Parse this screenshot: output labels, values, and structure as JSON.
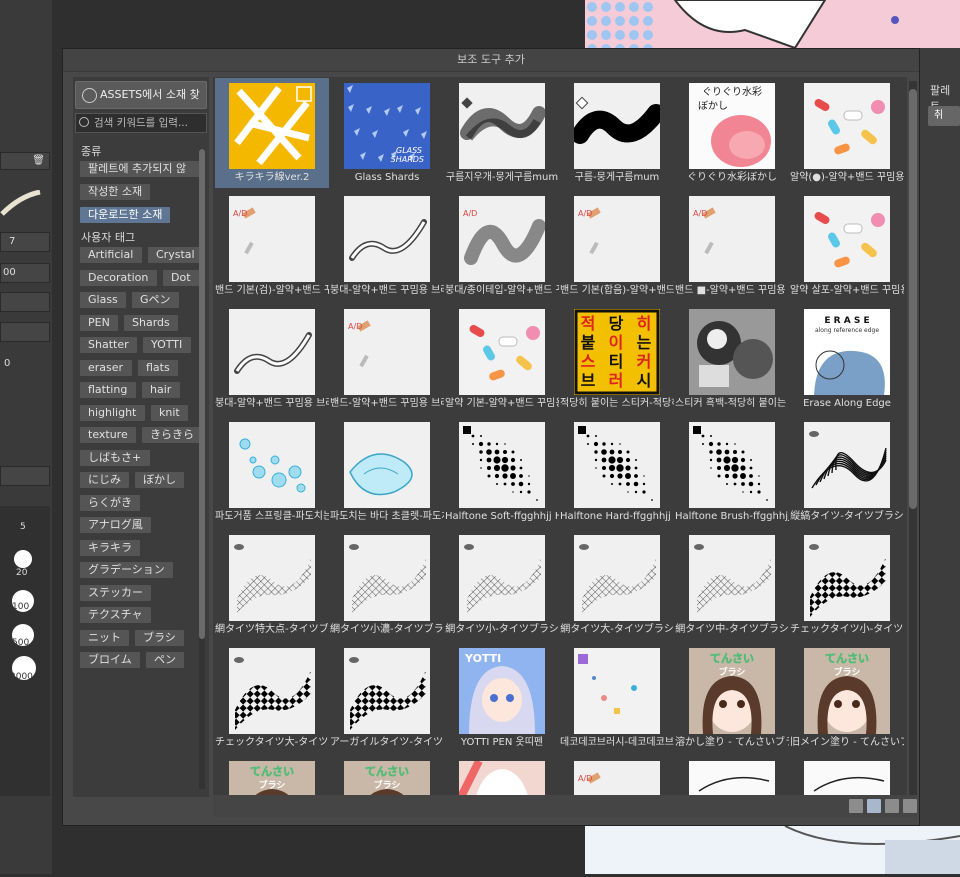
{
  "dialog": {
    "title": "보조 도구 추가",
    "assets_button": "ASSETS에서 소재 찾기",
    "search_placeholder": "검색 키워드를 입력...",
    "type_section": "종류",
    "type_items": [
      {
        "label": "팔레트에 추가되지 않",
        "selected": false
      },
      {
        "label": "작성한 소재",
        "selected": false
      },
      {
        "label": "다운로드한 소재",
        "selected": true
      }
    ],
    "user_tag_section": "사용자 태그",
    "tags": [
      "Artificial",
      "Crystal",
      "Decoration",
      "Dot",
      "Glass",
      "Gペン",
      "PEN",
      "Shards",
      "Shatter",
      "YOTTI",
      "eraser",
      "flats",
      "flatting",
      "hair",
      "highlight",
      "knit",
      "texture",
      "きらきら",
      "しばもさ+",
      "にじみ",
      "ぼかし",
      "らくがき",
      "アナログ風",
      "キラキラ",
      "グラデーション",
      "ステッカー",
      "テクスチャ",
      "ニット",
      "ブラシ",
      "ブロイム",
      "ペン"
    ],
    "items": [
      {
        "caption": "キラキラ線ver.2",
        "selected": true,
        "icon": "sparkle-lines"
      },
      {
        "caption": "Glass Shards",
        "icon": "glass-shards"
      },
      {
        "caption": "구름지우개-뭉게구름mum",
        "icon": "cloud-eraser"
      },
      {
        "caption": "구름-뭉게구름mum",
        "icon": "cloud-brush"
      },
      {
        "caption": "ぐりぐり水彩ぼかし",
        "icon": "watercolor"
      },
      {
        "caption": "알약(●)-알약+밴드 꾸밈용 브",
        "icon": "pill"
      },
      {
        "caption": "밴드 기본(검)-알약+밴드 꾸밈",
        "icon": "bandage"
      },
      {
        "caption": "붕대-알약+밴드 꾸밈용 브러",
        "icon": "wave-stroke"
      },
      {
        "caption": "붕대/종이테입-알약+밴드 꾸",
        "icon": "tape-stroke"
      },
      {
        "caption": "밴드 기본(합음)-알약+밴드 꾸",
        "icon": "bandage"
      },
      {
        "caption": "밴드 ■-알약+밴드 꾸밈용 브",
        "icon": "bandage"
      },
      {
        "caption": "알약 살포-알약+밴드 꾸밈용",
        "icon": "pill"
      },
      {
        "caption": "붕대-알약+밴드 꾸밈용 브러",
        "icon": "wave-stroke"
      },
      {
        "caption": "밴드-알약+밴드 꾸밈용 브러",
        "icon": "bandage"
      },
      {
        "caption": "알약 기본-알약+밴드 꾸밈용",
        "icon": "pill"
      },
      {
        "caption": "적당히 붙이는 스티커-적당히",
        "icon": "sticker",
        "thumb_text": "적 당 히 붙 이 는 스 티 커 브 러 시"
      },
      {
        "caption": "스티커 흑백-적당히 붙이는 스",
        "icon": "sticker-bw"
      },
      {
        "caption": "Erase Along Edge",
        "icon": "erase-edge",
        "thumb_text": "E R A S E",
        "thumb_subtext": "along reference edge"
      },
      {
        "caption": "파도거품 스프링클-파도치는",
        "icon": "bubbles"
      },
      {
        "caption": "파도치는 바다 초클렛-파도치",
        "icon": "shell"
      },
      {
        "caption": "Halftone Soft-ffgghhjj Halfto",
        "icon": "halftone"
      },
      {
        "caption": "Halftone Hard-ffgghhjj Halfto",
        "icon": "halftone"
      },
      {
        "caption": "Halftone Brush-ffgghhjj Halft",
        "icon": "halftone"
      },
      {
        "caption": "縦縞タイツ-タイツブラシ",
        "icon": "stripes"
      },
      {
        "caption": "網タイツ特大点-タイツブラシ",
        "icon": "fishnet"
      },
      {
        "caption": "網タイツ小濃-タイツブラシ",
        "icon": "fishnet"
      },
      {
        "caption": "網タイツ小-タイツブラシ",
        "icon": "fishnet"
      },
      {
        "caption": "網タイツ大-タイツブラシ",
        "icon": "fishnet"
      },
      {
        "caption": "網タイツ中-タイツブラシ",
        "icon": "fishnet"
      },
      {
        "caption": "チェックタイツ小-タイツブラ",
        "icon": "checker"
      },
      {
        "caption": "チェックタイツ大-タイツブラ",
        "icon": "checker"
      },
      {
        "caption": "アーガイルタイツ-タイツブラ",
        "icon": "argyle"
      },
      {
        "caption": "YOTTI PEN 옷띠펜",
        "icon": "yotti",
        "thumb_text": "YOTTI"
      },
      {
        "caption": "데코데코브러시-데코데코브러",
        "icon": "deco"
      },
      {
        "caption": "溶かし塗り - てんさいブラシ",
        "icon": "tensai",
        "thumb_text": "てんさい ブラシ"
      },
      {
        "caption": "旧メイン塗り - てんさいブラシ",
        "icon": "tensai",
        "thumb_text": "てんさい ブラシ"
      },
      {
        "caption": "",
        "icon": "tensai",
        "thumb_text": "てんさい ブラシ"
      },
      {
        "caption": "",
        "icon": "tensai",
        "thumb_text": "てんさい ブラシ"
      },
      {
        "caption": "",
        "icon": "girl"
      },
      {
        "caption": "",
        "icon": "bandage"
      },
      {
        "caption": "",
        "icon": "sketch"
      },
      {
        "caption": "",
        "icon": "sketch"
      }
    ],
    "right_label": "팔레트",
    "right_button": "취"
  },
  "background": {
    "left_values": [
      "7",
      "00",
      "0"
    ],
    "brush_sizes": [
      "5",
      "20",
      "100",
      "500",
      "2000",
      "7",
      "0",
      "0",
      "00"
    ]
  },
  "colors": {
    "dialog_bg": "#484848",
    "selected": "#5a6f8a",
    "tag_selected": "#5f7794",
    "tag_bg": "#555555"
  }
}
